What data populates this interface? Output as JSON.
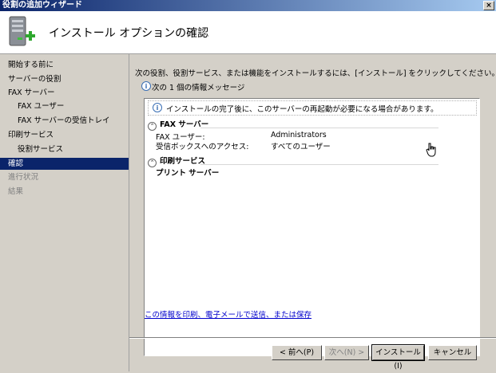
{
  "window": {
    "title": "役割の追加ウィザード",
    "close_glyph": "×"
  },
  "header": {
    "title": "インストール オプションの確認"
  },
  "sidebar": {
    "items": [
      {
        "label": "開始する前に",
        "state": "normal",
        "indent": false
      },
      {
        "label": "サーバーの役割",
        "state": "normal",
        "indent": false
      },
      {
        "label": "FAX サーバー",
        "state": "normal",
        "indent": false
      },
      {
        "label": "FAX ユーザー",
        "state": "normal",
        "indent": true
      },
      {
        "label": "FAX サーバーの受信トレイ",
        "state": "normal",
        "indent": true
      },
      {
        "label": "印刷サービス",
        "state": "normal",
        "indent": false
      },
      {
        "label": "役割サービス",
        "state": "normal",
        "indent": true
      },
      {
        "label": "確認",
        "state": "current",
        "indent": false
      },
      {
        "label": "進行状況",
        "state": "disabled",
        "indent": false
      },
      {
        "label": "結果",
        "state": "disabled",
        "indent": false
      }
    ]
  },
  "main": {
    "intro": "次の役割、役割サービス、または機能をインストールするには、[インストール] をクリックしてください。",
    "message_count": "次の 1 個の情報メッセージ",
    "notice": "インストールの完了後に、このサーバーの再起動が必要になる場合があります。",
    "sections": [
      {
        "title": "FAX サーバー",
        "properties": [
          {
            "label": "FAX ユーザー:",
            "value": "Administrators"
          },
          {
            "label": "受信ボックスへのアクセス:",
            "value": "すべてのユーザー"
          }
        ]
      },
      {
        "title": "印刷サービス",
        "items": [
          "プリント サーバー"
        ]
      }
    ],
    "link": "この情報を印刷、電子メールで送信、または保存"
  },
  "buttons": {
    "back": "< 前へ(P)",
    "next": "次へ(N) >",
    "install": "インストール(I)",
    "cancel": "キャンセル"
  }
}
